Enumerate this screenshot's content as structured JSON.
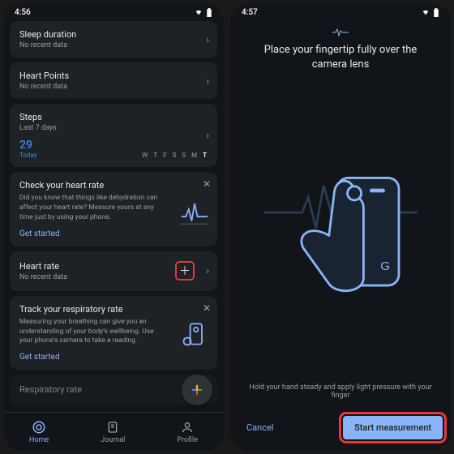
{
  "left": {
    "time": "4:56",
    "cards": {
      "sleep": {
        "title": "Sleep duration",
        "sub": "No recent data"
      },
      "points": {
        "title": "Heart Points",
        "sub": "No recent data"
      },
      "steps": {
        "title": "Steps",
        "sub": "Last 7 days",
        "value": "29",
        "value_label": "Today"
      }
    },
    "days": [
      "W",
      "T",
      "F",
      "S",
      "S",
      "M",
      "T"
    ],
    "promo1": {
      "title": "Check your heart rate",
      "body": "Did you know that things like dehydration can affect your heart rate? Measure yours at any time just by using your phone.",
      "action": "Get started"
    },
    "heartrate": {
      "title": "Heart rate",
      "sub": "No recent data"
    },
    "promo2": {
      "title": "Track your respiratory rate",
      "body": "Measuring your breathing can give you an understanding of your body's wellbeing. Use your phone's camera to take a reading.",
      "action": "Get started"
    },
    "resp": {
      "title": "Respiratory rate"
    },
    "nav": {
      "home": "Home",
      "journal": "Journal",
      "profile": "Profile"
    }
  },
  "right": {
    "time": "4:57",
    "title": "Place your fingertip fully over the camera lens",
    "hint": "Hold your hand steady and apply light pressure with your finger",
    "cancel": "Cancel",
    "start": "Start measurement"
  }
}
